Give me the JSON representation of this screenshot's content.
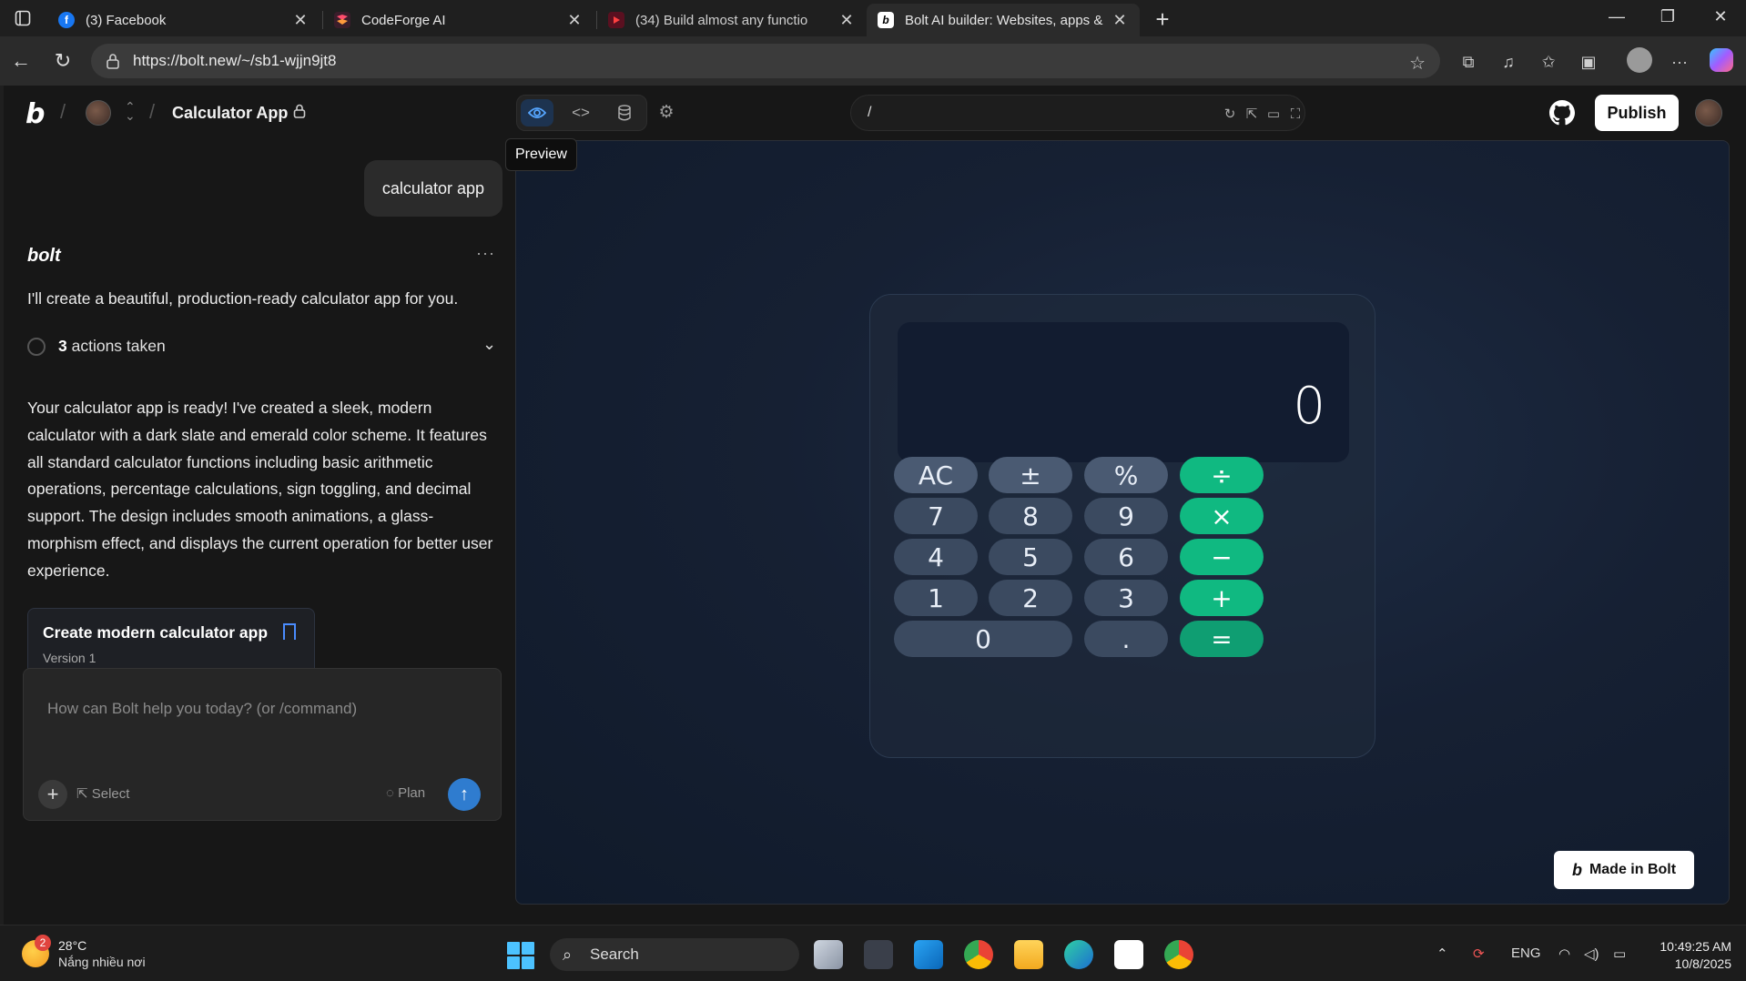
{
  "browser": {
    "tabs": [
      {
        "title": "(3) Facebook",
        "favicon": "facebook-icon",
        "color": "#1877f2"
      },
      {
        "title": "CodeForge AI",
        "favicon": "codeforge-icon",
        "color": "#e24"
      },
      {
        "title": "(34) Build almost any functio",
        "favicon": "youtube-icon",
        "color": "#c00"
      },
      {
        "title": "Bolt AI builder: Websites, apps &",
        "favicon": "bolt-icon",
        "color": "#fff"
      }
    ],
    "new_tab": "+",
    "url": "https://bolt.new/~/sb1-wjjn9jt8"
  },
  "app": {
    "logo": "b",
    "project_title": "Calculator App",
    "tooltip": "Preview",
    "preview_path": "/",
    "publish_label": "Publish"
  },
  "chat": {
    "user_message": "calculator app",
    "assistant_name": "bolt",
    "more": "···",
    "intro": "I'll create a beautiful, production-ready calculator app for you.",
    "actions_count": "3",
    "actions_label": "actions taken",
    "reply": "Your calculator app is ready! I've created a sleek, modern calculator with a dark slate and emerald color scheme. It features all standard calculator functions including basic arithmetic operations, percentage calculations, sign toggling, and decimal support. The design includes smooth animations, a glass-morphism effect, and displays the current operation for better user experience.",
    "artifact": {
      "title": "Create modern calculator app",
      "version": "Version 1"
    },
    "composer": {
      "placeholder": "How can Bolt help you today? (or /command)",
      "select_label": "Select",
      "plan_label": "Plan"
    }
  },
  "calculator": {
    "display": "0",
    "keys": {
      "ac": "AC",
      "sign": "±",
      "percent": "%",
      "divide": "÷",
      "seven": "7",
      "eight": "8",
      "nine": "9",
      "multiply": "×",
      "four": "4",
      "five": "5",
      "six": "6",
      "minus": "−",
      "one": "1",
      "two": "2",
      "three": "3",
      "plus": "+",
      "zero": "0",
      "dot": ".",
      "equals": "="
    },
    "accent_color": "#10b981"
  },
  "made_in": {
    "logo": "b",
    "label": "Made in Bolt"
  },
  "taskbar": {
    "weather_badge": "2",
    "temperature": "28°C",
    "condition": "Nắng nhiều nơi",
    "search_label": "Search",
    "language": "ENG",
    "time": "10:49:25 AM",
    "date": "10/8/2025"
  }
}
